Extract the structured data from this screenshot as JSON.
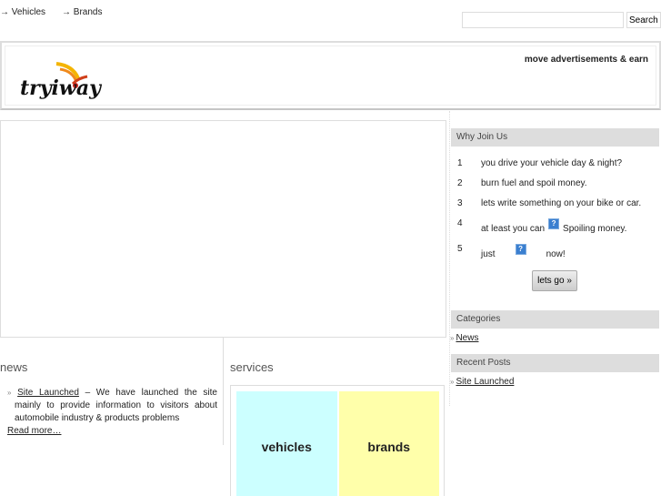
{
  "topnav": [
    {
      "label": "→ Vehicles"
    },
    {
      "label": "→ Brands"
    }
  ],
  "search": {
    "value": "",
    "placeholder": "",
    "button": "Search"
  },
  "header": {
    "logo_text": "tryiway",
    "tagline": "move advertisements & earn"
  },
  "sidebar": {
    "why_join": {
      "title": "Why Join Us",
      "items": [
        {
          "num": "1",
          "text": "you drive your vehicle day & night?"
        },
        {
          "num": "2",
          "text": "burn fuel and spoil money."
        },
        {
          "num": "3",
          "text": "lets write something on your bike or car."
        },
        {
          "num": "4",
          "pre": "at least you can",
          "post": "Spoiling money."
        },
        {
          "num": "5",
          "pre": "just",
          "post": "now!"
        }
      ],
      "button": "lets go »"
    },
    "categories": {
      "title": "Categories",
      "items": [
        {
          "label": "News"
        }
      ]
    },
    "recent_posts": {
      "title": "Recent Posts",
      "items": [
        {
          "label": "Site Launched"
        }
      ]
    },
    "bullet": "»"
  },
  "news": {
    "title": "news",
    "items": [
      {
        "link": "Site Launched",
        "text": " – We have launched the site mainly to provide information to visitors about automobile industry & products problems"
      }
    ],
    "read_more": "Read more…"
  },
  "services": {
    "title": "services",
    "tiles": [
      {
        "label": "vehicles",
        "color": "#ccffff"
      },
      {
        "label": "brands",
        "color": "#ffffaa"
      }
    ]
  }
}
